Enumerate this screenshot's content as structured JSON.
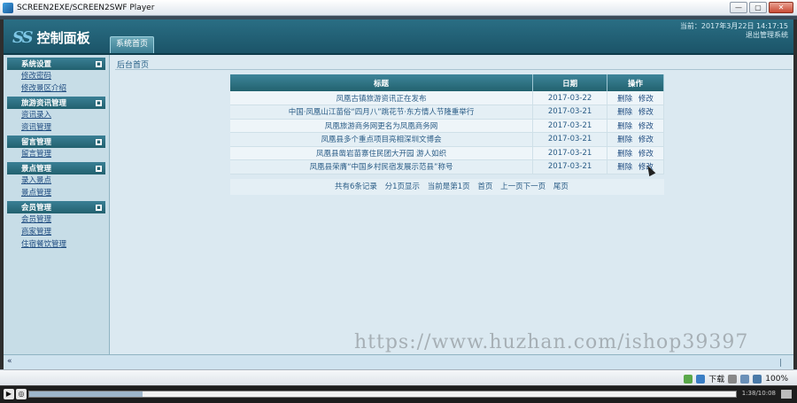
{
  "player": {
    "title": "SCREEN2EXE/SCREEN2SWF Player",
    "time": "1:38/10:08",
    "progress": 0.16
  },
  "header": {
    "logo_mark": "SS",
    "logo_text": "控制面板",
    "home_tab": "系统首页",
    "datetime": "当前：2017年3月22日  14:17:15",
    "logout": "退出管理系统"
  },
  "sidebar": {
    "groups": [
      {
        "title": "系统设置",
        "items": [
          "修改密码",
          "修改景区介绍"
        ]
      },
      {
        "title": "旅游资讯管理",
        "items": [
          "资讯录入",
          "资讯管理"
        ]
      },
      {
        "title": "留言管理",
        "items": [
          "留言管理"
        ]
      },
      {
        "title": "景点管理",
        "items": [
          "录入景点",
          "景点管理"
        ]
      },
      {
        "title": "会员管理",
        "items": [
          "会员管理",
          "商家管理",
          "住宿餐饮管理"
        ]
      }
    ],
    "toggle_glyph": "▪"
  },
  "main": {
    "breadcrumb": "后台首页",
    "columns": [
      "标题",
      "日期",
      "操作"
    ],
    "rows": [
      {
        "title": "凤凰古镇旅游资讯正在发布",
        "date": "2017-03-22"
      },
      {
        "title": "中国·凤凰山江苗俗“四月八”跳花节·东方情人节隆重举行",
        "date": "2017-03-21"
      },
      {
        "title": "凤凰旅游商务网更名为凤凰商务网",
        "date": "2017-03-21"
      },
      {
        "title": "凤凰县多个重点项目亮相深圳文博会",
        "date": "2017-03-21"
      },
      {
        "title": "凤凰县凿岩苗寨住民团大开园 游人如织",
        "date": "2017-03-21"
      },
      {
        "title": "凤凰县荣膺“中国乡村民宿发展示范县”称号",
        "date": "2017-03-21"
      }
    ],
    "op_delete": "删除",
    "op_edit": "修改",
    "pager": {
      "total": "共有6条记录",
      "per_page": "分1页显示",
      "current": "当前是第1页",
      "first": "首页",
      "prev_next": "上一页下一页",
      "last": "尾页"
    },
    "watermark": "https://www.huzhan.com/ishop39397"
  },
  "bottom": {
    "collapse_glyph": "«",
    "download": "下载",
    "zoom": "100%"
  }
}
